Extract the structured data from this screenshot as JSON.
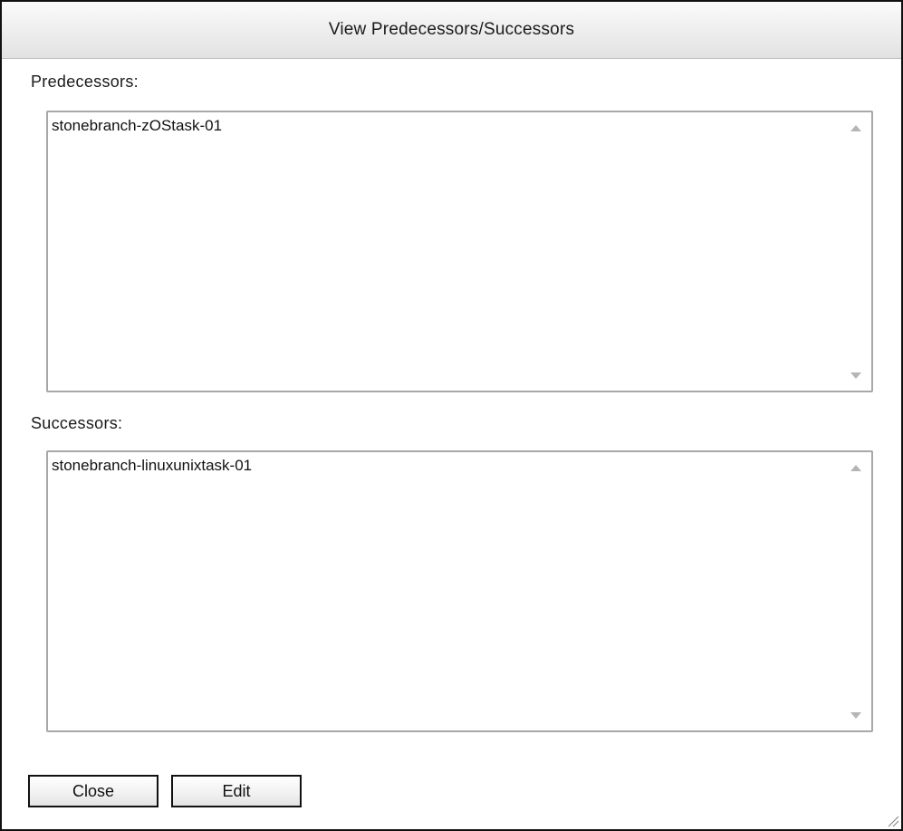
{
  "dialog": {
    "title": "View Predecessors/Successors"
  },
  "predecessors": {
    "label": "Predecessors:",
    "items": [
      "stonebranch-zOStask-01"
    ]
  },
  "successors": {
    "label": "Successors:",
    "items": [
      "stonebranch-linuxunixtask-01"
    ]
  },
  "buttons": {
    "close_label": "Close",
    "edit_label": "Edit"
  },
  "icons": {
    "scroll_up": "chevron-up-icon",
    "scroll_down": "chevron-down-icon",
    "resize": "resize-grip-icon"
  },
  "colors": {
    "border": "#111111",
    "title_bar": "#ededed",
    "list_border": "#a8a8a8",
    "scroll_arrow": "#b5b5b5"
  }
}
